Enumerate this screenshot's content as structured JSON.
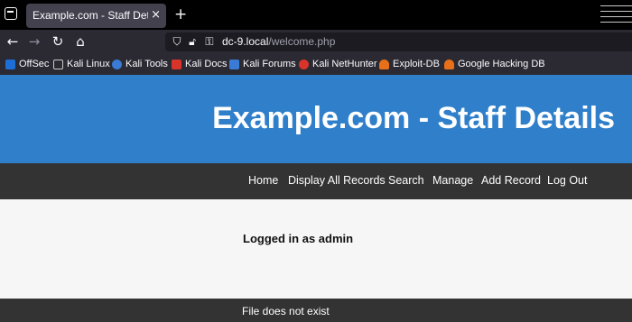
{
  "browser": {
    "tab": {
      "title": "Example.com - Staff Details",
      "close": "×"
    },
    "new_tab": "+",
    "address": {
      "host": "dc-9.local",
      "path": "/welcome.php"
    },
    "bookmarks": [
      {
        "label": "OffSec",
        "color": "#1d6fd6"
      },
      {
        "label": "Kali Linux",
        "color": "#2b2a33"
      },
      {
        "label": "Kali Tools",
        "color": "#3a7bd5"
      },
      {
        "label": "Kali Docs",
        "color": "#d9342b"
      },
      {
        "label": "Kali Forums",
        "color": "#3a7bd5"
      },
      {
        "label": "Kali NetHunter",
        "color": "#d9342b"
      },
      {
        "label": "Exploit-DB",
        "color": "#e8701a"
      },
      {
        "label": "Google Hacking DB",
        "color": "#e8701a"
      }
    ]
  },
  "site": {
    "title": "Example.com - Staff Details",
    "nav": [
      "Home",
      "Display All Records",
      "Search",
      "Manage",
      "Add Record",
      "Log Out"
    ],
    "message": "Logged in as admin",
    "footer": "File does not exist"
  },
  "colors": {
    "header": "#2f7fca",
    "nav": "#333333",
    "content_bg": "#f6f6f6"
  }
}
